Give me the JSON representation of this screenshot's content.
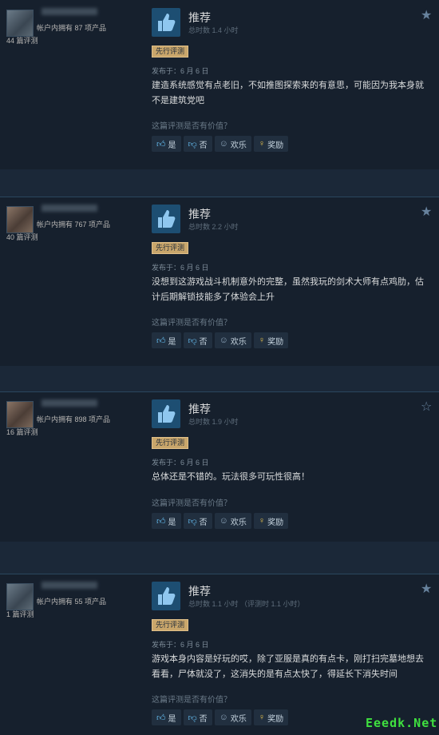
{
  "reviews": [
    {
      "owned": "帐户内拥有 87 项产品",
      "review_count": "44 篇评测",
      "verdict": "推荐",
      "hours": "总时数 1.4 小时",
      "badge": "先行评测",
      "posted": "发布于：6 月 6 日",
      "text": "建造系统感觉有点老旧，不如推图探索来的有意思，可能因为我本身就不是建筑党吧",
      "helpful_q": "这篇评测是否有价值？",
      "yes": "是",
      "no": "否",
      "funny": "欢乐",
      "award": "奖励",
      "star_filled": true
    },
    {
      "owned": "帐户内拥有 767 项产品",
      "review_count": "40 篇评测",
      "verdict": "推荐",
      "hours": "总时数 2.2 小时",
      "badge": "先行评测",
      "posted": "发布于：6 月 6 日",
      "text": "没想到这游戏战斗机制意外的完整，虽然我玩的剑术大师有点鸡肋，估计后期解锁技能多了体验会上升",
      "helpful_q": "这篇评测是否有价值？",
      "yes": "是",
      "no": "否",
      "funny": "欢乐",
      "award": "奖励",
      "star_filled": true
    },
    {
      "owned": "帐户内拥有 898 项产品",
      "review_count": "16 篇评测",
      "verdict": "推荐",
      "hours": "总时数 1.9 小时",
      "badge": "先行评测",
      "posted": "发布于：6 月 6 日",
      "text": "总体还是不错的。玩法很多可玩性很高！",
      "helpful_q": "这篇评测是否有价值？",
      "yes": "是",
      "no": "否",
      "funny": "欢乐",
      "award": "奖励",
      "star_filled": false
    },
    {
      "owned": "帐户内拥有 55 项产品",
      "review_count": "1 篇评测",
      "verdict": "推荐",
      "hours": "总时数 1.1 小时 （评测时 1.1 小时）",
      "badge": "先行评测",
      "posted": "发布于：6 月 6 日",
      "text": "游戏本身内容是好玩的哎，除了亚服是真的有点卡，刚打扫完墓地想去看看，尸体就没了，这消失的是有点太快了，得延长下消失时间",
      "helpful_q": "这篇评测是否有价值？",
      "yes": "是",
      "no": "否",
      "funny": "欢乐",
      "award": "奖励",
      "star_filled": true
    }
  ],
  "watermark": "Eeedk.Net",
  "colors": {
    "background": "#1b2838",
    "card": "#16202d",
    "badge": "#c9a66b",
    "thumb_box": "#1d4e72"
  }
}
